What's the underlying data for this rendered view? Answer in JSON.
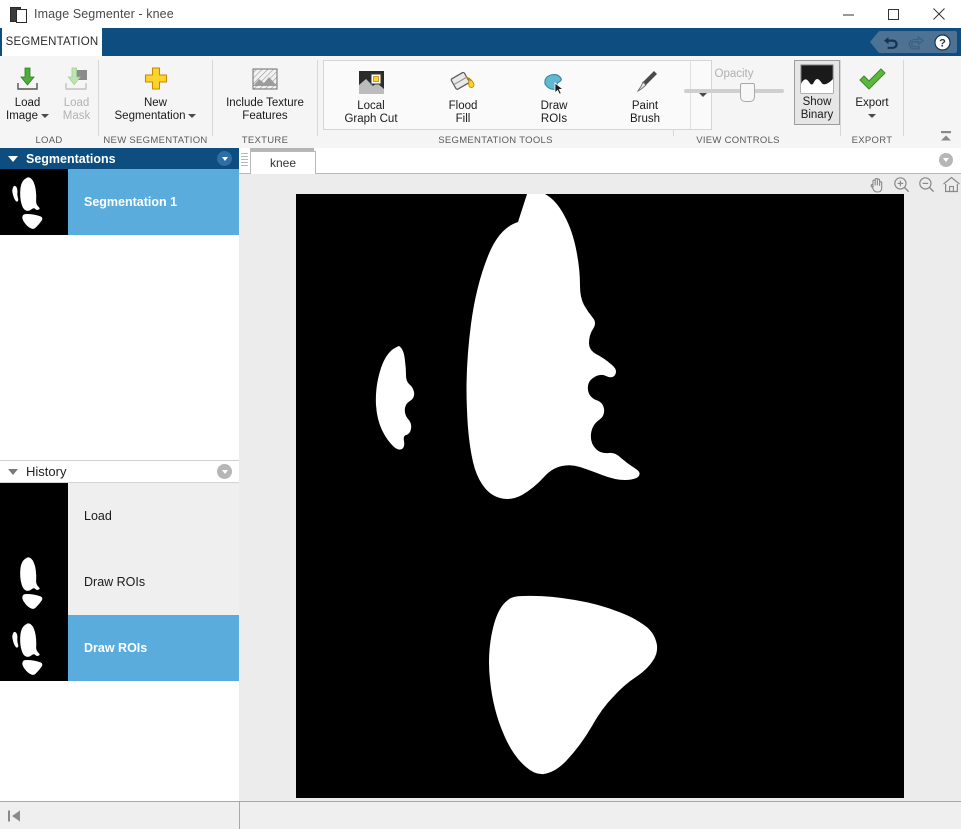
{
  "window": {
    "title": "Image Segmenter - knee",
    "icon": "app-icon",
    "minimize_label": "—",
    "maximize_label": "□",
    "close_label": "✕"
  },
  "ribbon": {
    "active_tab": "SEGMENTATION",
    "quick_access": {
      "undo": "undo-icon",
      "redo": "redo-icon",
      "help": "help-icon"
    },
    "collapse_icon": "collapse-ribbon-icon",
    "sections": [
      {
        "label": "LOAD",
        "buttons": [
          {
            "line1": "Load",
            "line2": "Image",
            "has_caret": true,
            "disabled": false,
            "icon": "load-image-icon"
          },
          {
            "line1": "Load",
            "line2": "Mask",
            "has_caret": false,
            "disabled": true,
            "icon": "load-mask-icon"
          }
        ]
      },
      {
        "label": "NEW SEGMENTATION",
        "buttons": [
          {
            "line1": "New",
            "line2": "Segmentation",
            "has_caret": true,
            "disabled": false,
            "icon": "new-segmentation-icon"
          }
        ]
      },
      {
        "label": "TEXTURE",
        "buttons": [
          {
            "line1": "Include Texture",
            "line2": "Features",
            "has_caret": false,
            "disabled": false,
            "icon": "texture-icon"
          }
        ]
      },
      {
        "label": "SEGMENTATION TOOLS",
        "buttons": [
          {
            "line1": "Local",
            "line2": "Graph Cut",
            "has_caret": false,
            "disabled": false,
            "icon": "local-graph-cut-icon"
          },
          {
            "line1": "Flood",
            "line2": "Fill",
            "has_caret": false,
            "disabled": false,
            "icon": "flood-fill-icon"
          },
          {
            "line1": "Draw",
            "line2": "ROIs",
            "has_caret": false,
            "disabled": false,
            "icon": "draw-rois-icon"
          },
          {
            "line1": "Paint",
            "line2": "Brush",
            "has_caret": false,
            "disabled": false,
            "icon": "paint-brush-icon"
          }
        ],
        "overflow_icon": "more-tools-icon"
      },
      {
        "label": "VIEW CONTROLS",
        "opacity_label": "Opacity",
        "opacity_value": 56,
        "show_binary": {
          "line1": "Show",
          "line2": "Binary",
          "pressed": true,
          "icon": "show-binary-icon"
        }
      },
      {
        "label": "EXPORT",
        "buttons": [
          {
            "line1": "Export",
            "line2": "",
            "has_caret": true,
            "disabled": false,
            "icon": "export-icon"
          }
        ]
      }
    ]
  },
  "segmentations_panel": {
    "title": "Segmentations",
    "options_icon": "panel-options-icon",
    "collapse_icon": "panel-collapse-icon",
    "items": [
      {
        "label": "Segmentation 1",
        "selected": true,
        "thumbnail": "segmentation-thumbnail"
      }
    ]
  },
  "history_panel": {
    "title": "History",
    "options_icon": "panel-options-icon",
    "collapse_icon": "panel-collapse-icon",
    "items": [
      {
        "label": "Load",
        "selected": false,
        "thumbnail": "history-thumbnail-empty"
      },
      {
        "label": "Draw ROIs",
        "selected": false,
        "thumbnail": "history-thumbnail-2"
      },
      {
        "label": "Draw ROIs",
        "selected": true,
        "thumbnail": "history-thumbnail-3"
      }
    ]
  },
  "document": {
    "tab_label": "knee",
    "options_icon": "document-options-icon",
    "image_tools": [
      {
        "name": "pan-icon",
        "label": "Pan"
      },
      {
        "name": "zoom-in-icon",
        "label": "Zoom In"
      },
      {
        "name": "zoom-out-icon",
        "label": "Zoom Out"
      },
      {
        "name": "reset-view-icon",
        "label": "Restore Original View"
      }
    ],
    "canvas": {
      "background_color": "#000000",
      "foreground_color": "#ffffff",
      "display_mode": "binary-mask"
    }
  },
  "statusbar": {
    "nav_icon": "first-step-icon"
  },
  "colors": {
    "ribbon_tab_bar": "#0e4d80",
    "selection_blue": "#59acdc",
    "panel_header_dark": "#0e4d80",
    "ribbon_background": "#f5f5f5"
  }
}
